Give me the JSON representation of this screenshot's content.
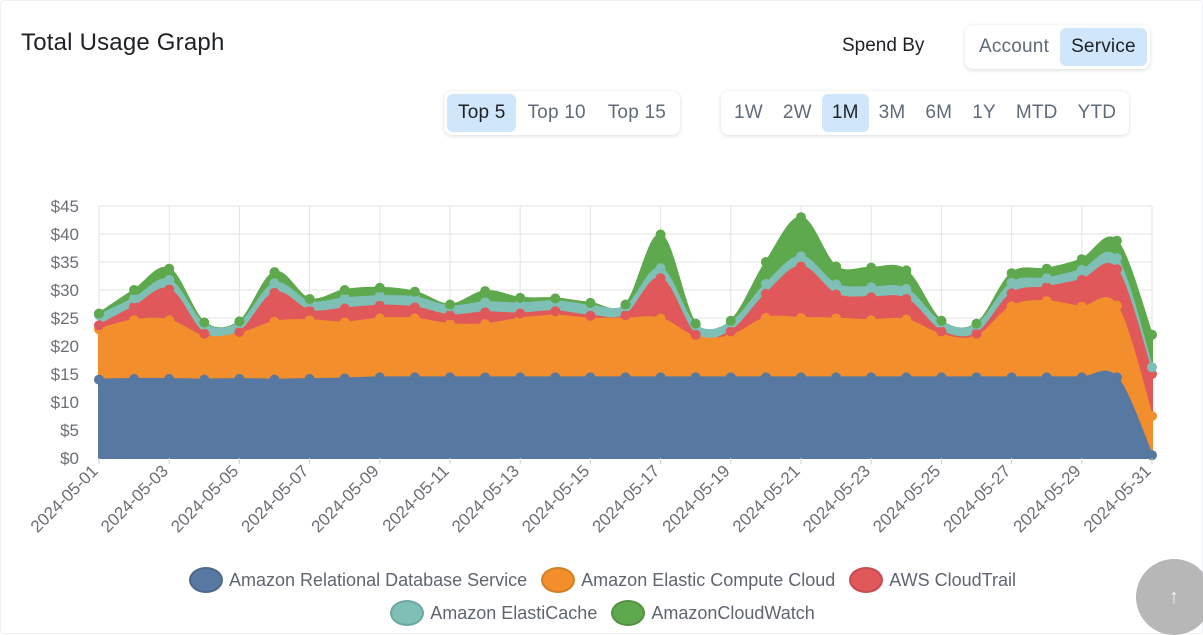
{
  "header": {
    "title": "Total Usage Graph",
    "spend_by_label": "Spend By"
  },
  "spend_by": {
    "options": [
      "Account",
      "Service"
    ],
    "selected": "Service"
  },
  "top_n": {
    "options": [
      "Top 5",
      "Top 10",
      "Top 15"
    ],
    "selected": "Top 5"
  },
  "time_range": {
    "options": [
      "1W",
      "2W",
      "1M",
      "3M",
      "6M",
      "1Y",
      "MTD",
      "YTD"
    ],
    "selected": "1M"
  },
  "scroll_top_icon": "arrow-up-icon",
  "chart_data": {
    "type": "area",
    "stacked": true,
    "title": "",
    "xlabel": "",
    "ylabel": "",
    "ylim": [
      0,
      45
    ],
    "yticks": [
      "$0",
      "$5",
      "$10",
      "$15",
      "$20",
      "$25",
      "$30",
      "$35",
      "$40",
      "$45"
    ],
    "ytick_values": [
      0,
      5,
      10,
      15,
      20,
      25,
      30,
      35,
      40,
      45
    ],
    "grid": true,
    "legend_position": "bottom",
    "x": [
      "2024-05-01",
      "2024-05-02",
      "2024-05-03",
      "2024-05-04",
      "2024-05-05",
      "2024-05-06",
      "2024-05-07",
      "2024-05-08",
      "2024-05-09",
      "2024-05-10",
      "2024-05-11",
      "2024-05-12",
      "2024-05-13",
      "2024-05-14",
      "2024-05-15",
      "2024-05-16",
      "2024-05-17",
      "2024-05-18",
      "2024-05-19",
      "2024-05-20",
      "2024-05-21",
      "2024-05-22",
      "2024-05-23",
      "2024-05-24",
      "2024-05-25",
      "2024-05-26",
      "2024-05-27",
      "2024-05-28",
      "2024-05-29",
      "2024-05-30",
      "2024-05-31"
    ],
    "xtick_labels": [
      "2024-05-01",
      "2024-05-03",
      "2024-05-05",
      "2024-05-07",
      "2024-05-09",
      "2024-05-11",
      "2024-05-13",
      "2024-05-15",
      "2024-05-17",
      "2024-05-19",
      "2024-05-21",
      "2024-05-23",
      "2024-05-25",
      "2024-05-27",
      "2024-05-29",
      "2024-05-31"
    ],
    "series": [
      {
        "name": "Amazon Relational Database Service",
        "color": "#5778a0",
        "values": [
          14.0,
          14.1,
          14.1,
          14.0,
          14.1,
          14.0,
          14.1,
          14.2,
          14.4,
          14.4,
          14.4,
          14.4,
          14.4,
          14.4,
          14.4,
          14.4,
          14.4,
          14.4,
          14.4,
          14.4,
          14.4,
          14.4,
          14.4,
          14.4,
          14.4,
          14.4,
          14.4,
          14.4,
          14.4,
          14.4,
          0.5
        ]
      },
      {
        "name": "Amazon Elastic Compute Cloud",
        "color": "#f28f2c",
        "values": [
          9.0,
          10.5,
          10.5,
          7.7,
          8.1,
          10.3,
          10.5,
          10.0,
          10.5,
          10.5,
          9.5,
          9.5,
          10.5,
          11.0,
          10.5,
          10.5,
          10.5,
          7.2,
          7.4,
          10.6,
          10.6,
          10.5,
          10.2,
          10.3,
          7.6,
          7.3,
          12.7,
          13.6,
          12.6,
          12.8,
          7.0
        ]
      },
      {
        "name": "AWS CloudTrail",
        "color": "#e0585a",
        "values": [
          0.7,
          2.4,
          5.5,
          0.5,
          0.3,
          5.2,
          1.7,
          2.5,
          2.3,
          2.0,
          1.6,
          2.1,
          0.9,
          0.8,
          0.5,
          0.6,
          7.2,
          0.4,
          0.8,
          4.3,
          9.2,
          4.3,
          4.1,
          3.7,
          0.6,
          0.5,
          2.3,
          2.5,
          4.8,
          6.5,
          7.5
        ]
      },
      {
        "name": "Amazon ElastiCache",
        "color": "#7ebfb6",
        "values": [
          1.8,
          1.5,
          1.7,
          1.7,
          1.6,
          1.7,
          1.6,
          1.8,
          1.7,
          1.8,
          1.6,
          1.8,
          1.8,
          1.8,
          1.8,
          1.6,
          1.8,
          1.7,
          1.6,
          1.8,
          1.8,
          1.8,
          1.8,
          1.8,
          1.6,
          1.6,
          1.9,
          1.6,
          1.8,
          2.0,
          1.2
        ]
      },
      {
        "name": "AmazonCloudWatch",
        "color": "#5ea84d",
        "values": [
          0.3,
          1.5,
          2.0,
          0.3,
          0.3,
          2.0,
          0.5,
          1.5,
          1.5,
          1.0,
          0.3,
          2.0,
          1.0,
          0.5,
          0.5,
          0.3,
          6.0,
          0.3,
          0.3,
          3.9,
          7.0,
          3.2,
          3.5,
          3.3,
          0.3,
          0.2,
          1.7,
          1.7,
          1.9,
          3.1,
          5.8
        ]
      }
    ]
  }
}
